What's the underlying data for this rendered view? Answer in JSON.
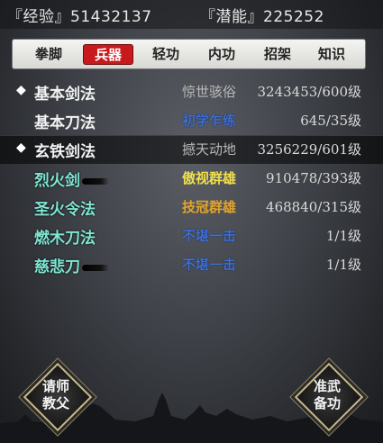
{
  "header": {
    "experience": "『经验』51432137",
    "potential": "『潜能』225252"
  },
  "tabs": [
    {
      "label": "拳脚",
      "active": false
    },
    {
      "label": "兵器",
      "active": true
    },
    {
      "label": "轻功",
      "active": false
    },
    {
      "label": "内功",
      "active": false
    },
    {
      "label": "招架",
      "active": false
    },
    {
      "label": "知识",
      "active": false
    }
  ],
  "skills": [
    {
      "marker": "◆",
      "name": "基本剑法",
      "rank": "惊世骇俗",
      "level": "3243453/600级"
    },
    {
      "marker": "",
      "name": "基本刀法",
      "rank": "初学乍练",
      "level": "645/35级"
    },
    {
      "marker": "◆",
      "name": "玄铁剑法",
      "rank": "撼天动地",
      "level": "3256229/601级"
    },
    {
      "marker": "",
      "name": "烈火剑",
      "rank": "傲视群雄",
      "level": "910478/393级"
    },
    {
      "marker": "",
      "name": "圣火令法",
      "rank": "技冠群雄",
      "level": "468840/315级"
    },
    {
      "marker": "",
      "name": "燃木刀法",
      "rank": "不堪一击",
      "level": "1/1级"
    },
    {
      "marker": "",
      "name": "慈悲刀",
      "rank": "不堪一击",
      "level": "1/1级"
    }
  ],
  "buttons": {
    "teacher": {
      "line1": "请师",
      "line2": "教父"
    },
    "prepare": {
      "line1": "准武",
      "line2": "备功"
    }
  },
  "colors": {
    "active_tab": "#c8191c",
    "rank_blue": "#3f6fd6",
    "rank_yellow": "#f1e04c",
    "rank_orange": "#e2a42c",
    "name_cyan": "#7fe7d4"
  }
}
